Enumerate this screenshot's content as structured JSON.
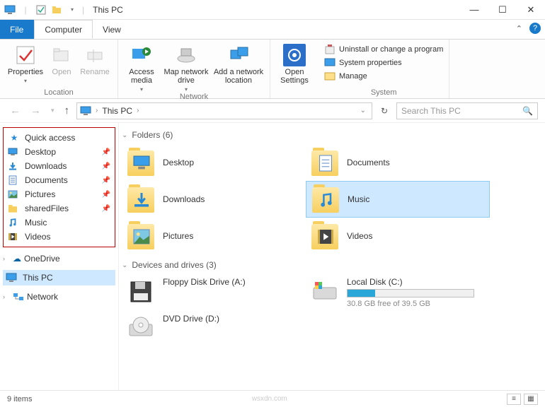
{
  "window": {
    "title": "This PC"
  },
  "tabs": {
    "file": "File",
    "computer": "Computer",
    "view": "View"
  },
  "ribbon": {
    "location": {
      "label": "Location",
      "properties": "Properties",
      "open": "Open",
      "rename": "Rename"
    },
    "network": {
      "label": "Network",
      "access_media": "Access media",
      "map_drive": "Map network drive",
      "add_location": "Add a network location"
    },
    "settings": {
      "label": "Open Settings",
      "btn": "Open Settings"
    },
    "system": {
      "label": "System",
      "uninstall": "Uninstall or change a program",
      "props": "System properties",
      "manage": "Manage"
    }
  },
  "address": {
    "root": "This PC"
  },
  "search": {
    "placeholder": "Search This PC"
  },
  "navpane": {
    "quick_access": "Quick access",
    "items": [
      {
        "label": "Desktop",
        "icon": "desktop",
        "pinned": true
      },
      {
        "label": "Downloads",
        "icon": "download",
        "pinned": true
      },
      {
        "label": "Documents",
        "icon": "document",
        "pinned": true
      },
      {
        "label": "Pictures",
        "icon": "picture",
        "pinned": true
      },
      {
        "label": "sharedFiles",
        "icon": "folder",
        "pinned": true
      },
      {
        "label": "Music",
        "icon": "music",
        "pinned": false
      },
      {
        "label": "Videos",
        "icon": "video",
        "pinned": false
      }
    ],
    "onedrive": "OneDrive",
    "thispc": "This PC",
    "network": "Network"
  },
  "folders_header": "Folders (6)",
  "folders": [
    {
      "label": "Desktop",
      "icon": "desktop"
    },
    {
      "label": "Documents",
      "icon": "document"
    },
    {
      "label": "Downloads",
      "icon": "download"
    },
    {
      "label": "Music",
      "icon": "music",
      "selected": true
    },
    {
      "label": "Pictures",
      "icon": "picture"
    },
    {
      "label": "Videos",
      "icon": "video"
    }
  ],
  "drives_header": "Devices and drives (3)",
  "drives": [
    {
      "label": "Floppy Disk Drive (A:)",
      "type": "floppy"
    },
    {
      "label": "Local Disk (C:)",
      "type": "hdd",
      "usage_pct": 22,
      "sub": "30.8 GB free of 39.5 GB"
    },
    {
      "label": "DVD Drive (D:)",
      "type": "dvd"
    }
  ],
  "status": {
    "items": "9 items"
  },
  "watermark": "wsxdn.com"
}
